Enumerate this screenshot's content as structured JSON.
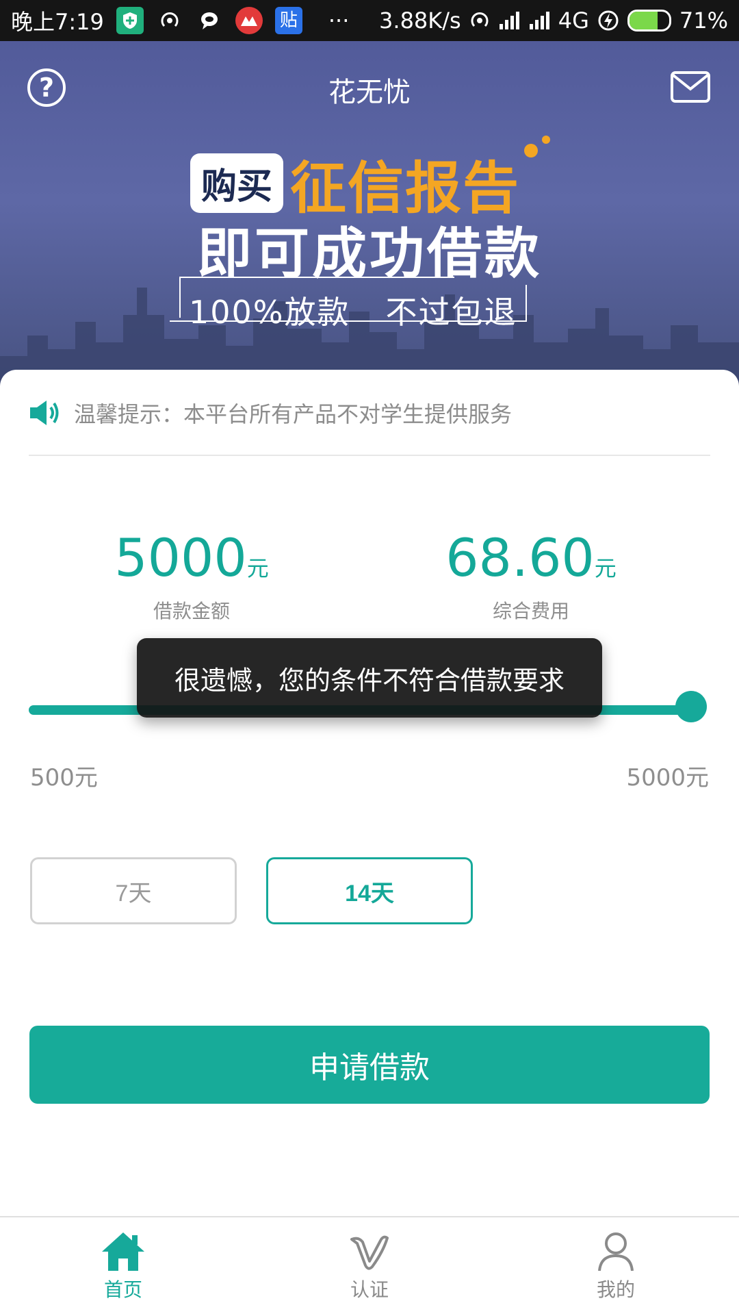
{
  "status_bar": {
    "time": "晚上7:19",
    "icons": [
      "shield-icon",
      "hotspot-icon",
      "chat-icon",
      "app-icon",
      "tieba-icon",
      "more-dots-icon"
    ],
    "more": "···",
    "tieba_char": "贴",
    "network_speed": "3.88K/s",
    "network_type": "4G",
    "battery_percent": "71%",
    "battery_level": 0.71
  },
  "header": {
    "title": "花无忧"
  },
  "banner": {
    "badge": "购买",
    "headline_orange": "征信报告",
    "headline_white": "即可成功借款",
    "slogan_left": "100%放款",
    "slogan_right": "不过包退",
    "accent_color": "#f4a623"
  },
  "notice": {
    "text": "温馨提示：本平台所有产品不对学生提供服务"
  },
  "loan": {
    "amount_value": "5000",
    "amount_unit": "元",
    "amount_label": "借款金额",
    "fee_value": "68.60",
    "fee_unit": "元",
    "fee_label": "综合费用",
    "slider_min_label": "500元",
    "slider_max_label": "5000元",
    "slider_value_fraction": 1.0,
    "terms": [
      {
        "label": "7天",
        "selected": false
      },
      {
        "label": "14天",
        "selected": true
      }
    ],
    "apply_label": "申请借款",
    "accent_color": "#16a99a"
  },
  "toast": {
    "message": "很遗憾，您的条件不符合借款要求"
  },
  "tabbar": {
    "items": [
      {
        "label": "首页",
        "icon": "home-icon",
        "active": true
      },
      {
        "label": "认证",
        "icon": "verify-icon",
        "active": false
      },
      {
        "label": "我的",
        "icon": "profile-icon",
        "active": false
      }
    ],
    "active_color": "#16a99a",
    "inactive_color": "#8a8a8a"
  }
}
